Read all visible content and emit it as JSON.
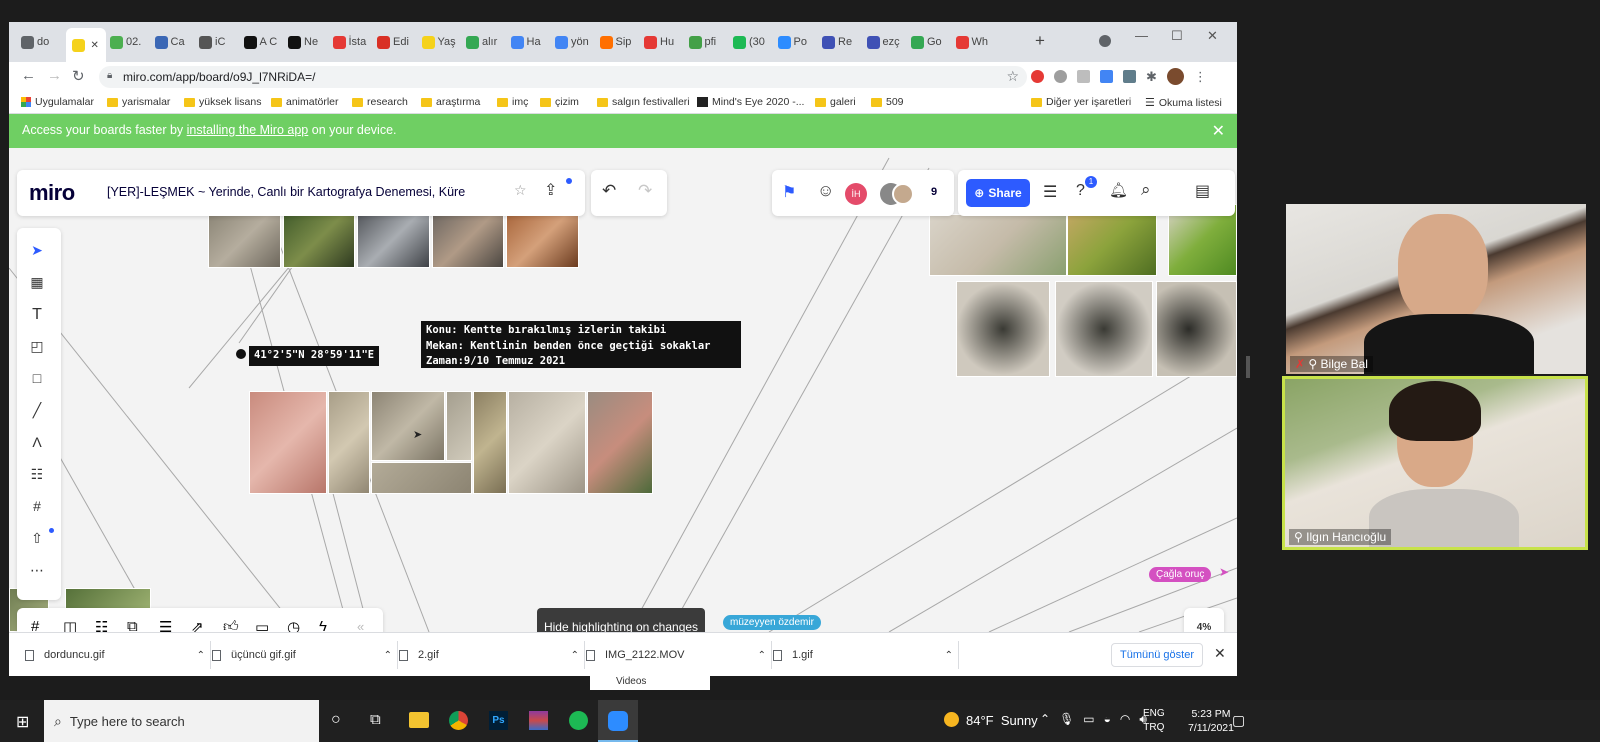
{
  "browser": {
    "tabs": [
      {
        "label": "do",
        "color": "#5f6368"
      },
      {
        "label": "",
        "color": "#f5d21b",
        "active": true
      },
      {
        "label": "02.",
        "color": "#4caf50"
      },
      {
        "label": "Ca",
        "color": "#3b67b5"
      },
      {
        "label": "iC",
        "color": "#555555"
      },
      {
        "label": "A C",
        "color": "#111111"
      },
      {
        "label": "Ne",
        "color": "#111111"
      },
      {
        "label": "İsta",
        "color": "#e53935"
      },
      {
        "label": "Edi",
        "color": "#d93025"
      },
      {
        "label": "Yaş",
        "color": "#f5d21b"
      },
      {
        "label": "alır",
        "color": "#34a853"
      },
      {
        "label": "Ha",
        "color": "#4285f4"
      },
      {
        "label": "yön",
        "color": "#4285f4"
      },
      {
        "label": "Sip",
        "color": "#ff6f00"
      },
      {
        "label": "Hu",
        "color": "#e53935"
      },
      {
        "label": "pfi",
        "color": "#43a047"
      },
      {
        "label": "(30",
        "color": "#1db954"
      },
      {
        "label": "Po",
        "color": "#2d8cff"
      },
      {
        "label": "Re",
        "color": "#3f51b5"
      },
      {
        "label": "ezç",
        "color": "#3f51b5"
      },
      {
        "label": "Go",
        "color": "#34a853"
      },
      {
        "label": "Wh",
        "color": "#e53935"
      }
    ],
    "new_tab": "+",
    "url": "miro.com/app/board/o9J_l7NRiDA=/",
    "bookmarks": [
      "Uygulamalar",
      "yarismalar",
      "yüksek lisans",
      "animatörler",
      "research",
      "araştırma",
      "imç",
      "çizim",
      "salgın festivalleri",
      "Mind's Eye 2020 -...",
      "galeri",
      "509"
    ],
    "other_bookmarks": "Diğer yer işaretleri",
    "reading_list": "Okuma listesi",
    "banner": {
      "pre": "Access your boards faster by ",
      "link": "installing the Miro app",
      "post": " on your device."
    }
  },
  "miro": {
    "logo": "miro",
    "board_title": "[YER]-LEŞMEK ~ Yerinde, Canlı bir Kartografya Denemesi, Küre",
    "collaborators_count": "9",
    "avatar_initials": "İH",
    "share_label": "Share",
    "help_badge": "1",
    "coordinate_label": "41°2'5\"N 28°59'11\"E",
    "note_lines": [
      "Konu: Kentte bırakılmış izlerin takibi",
      "Mekan: Kentlinin benden önce geçtiği sokaklar",
      "Zaman:9/10 Temmuz 2021"
    ],
    "tooltip": "Hide highlighting on changes",
    "cursor_users": [
      {
        "name": "Çağla oruç",
        "color": "#d450c1"
      },
      {
        "name": "müzeyyen özdemir",
        "color": "#38a7d8"
      }
    ],
    "zoom": "4%"
  },
  "downloads": {
    "items": [
      "dorduncu.gif",
      "üçüncü gif.gif",
      "2.gif",
      "IMG_2122.MOV",
      "1.gif"
    ],
    "show_all": "Tümünü göster",
    "underneath": "Videos"
  },
  "taskbar": {
    "search_placeholder": "Type here to search",
    "weather": "84°F  Sunny",
    "lang_top": "ENG",
    "lang_bottom": "TRQ",
    "time": "5:23 PM",
    "date": "7/11/2021"
  },
  "zoom": {
    "participants": [
      {
        "name": "Bilge Bal",
        "muted": true
      },
      {
        "name": "Ilgın Hancıoğlu",
        "muted": false,
        "speaking": true
      }
    ]
  }
}
